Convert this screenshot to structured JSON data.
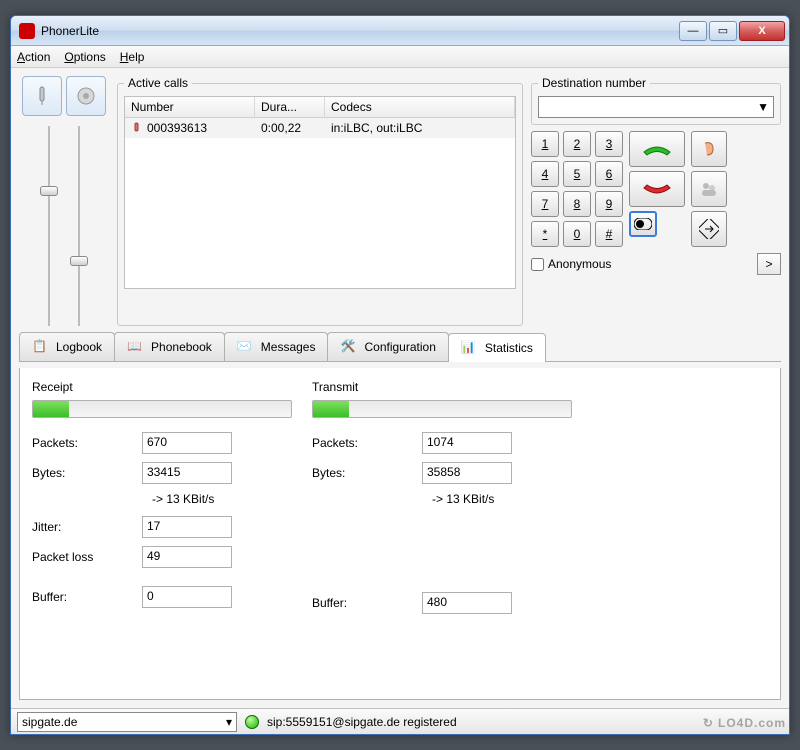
{
  "window": {
    "title": "PhonerLite",
    "min": "—",
    "max": "▭",
    "close": "X"
  },
  "menu": {
    "action": "Action",
    "options": "Options",
    "help": "Help"
  },
  "active_calls": {
    "legend": "Active calls",
    "cols": {
      "number": "Number",
      "duration": "Dura...",
      "codecs": "Codecs"
    },
    "row": {
      "number": "000393613",
      "duration": "0:00,22",
      "codecs": "in:iLBC, out:iLBC"
    }
  },
  "destination": {
    "legend": "Destination number",
    "value": "",
    "anonymous_label": "Anonymous",
    "gt": ">"
  },
  "keypad": {
    "k1": "1",
    "k2": "2",
    "k3": "3",
    "k4": "4",
    "k5": "5",
    "k6": "6",
    "k7": "7",
    "k8": "8",
    "k9": "9",
    "kstar": "*",
    "k0": "0",
    "khash": "#"
  },
  "tabs": {
    "logbook": "Logbook",
    "phonebook": "Phonebook",
    "messages": "Messages",
    "configuration": "Configuration",
    "statistics": "Statistics"
  },
  "stats": {
    "receipt": {
      "title": "Receipt",
      "packets_label": "Packets:",
      "packets": "670",
      "bytes_label": "Bytes:",
      "bytes": "33415",
      "rate": "-> 13    KBit/s",
      "jitter_label": "Jitter:",
      "jitter": "17",
      "loss_label": "Packet loss",
      "loss": "49",
      "buffer_label": "Buffer:",
      "buffer": "0",
      "fill_pct": 14
    },
    "transmit": {
      "title": "Transmit",
      "packets_label": "Packets:",
      "packets": "1074",
      "bytes_label": "Bytes:",
      "bytes": "35858",
      "rate": "-> 13    KBit/s",
      "buffer_label": "Buffer:",
      "buffer": "480",
      "fill_pct": 14
    }
  },
  "status": {
    "profile": "sipgate.de",
    "text": "sip:5559151@sipgate.de registered"
  },
  "watermark": "LO4D.com"
}
